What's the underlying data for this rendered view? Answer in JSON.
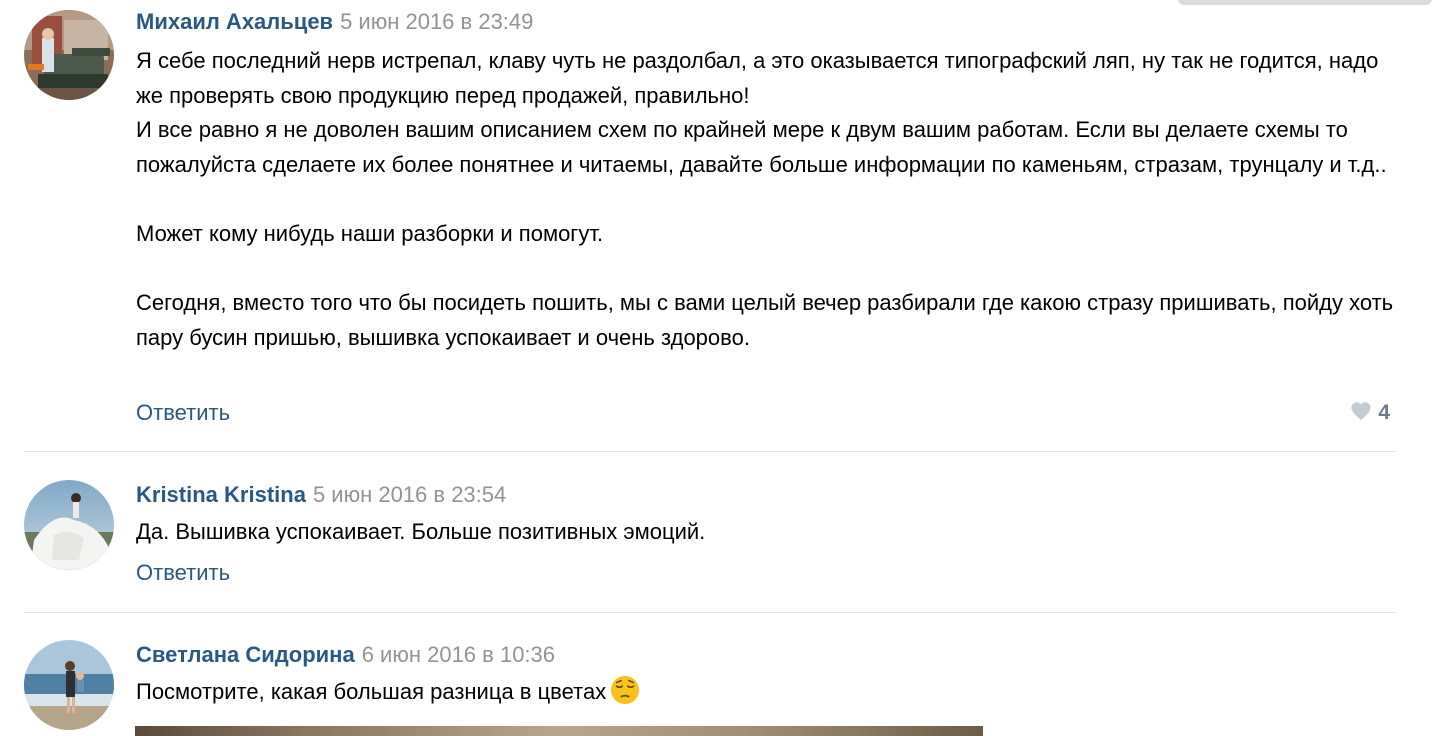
{
  "comments": [
    {
      "author": "Михаил Ахальцев",
      "date": "5 июн 2016 в 23:49",
      "paragraphs": [
        "Я себе последний нерв истрепал, клаву чуть не раздолбал, а это оказывается типографский ляп, ну так не годится, надо же проверять свою продукцию перед продажей, правильно!",
        "И все равно я не доволен вашим описанием схем по крайней мере к двум вашим работам. Если вы делаете схемы то пожалуйста сделаете их более понятнее и читаемы, давайте больше информации по каменьям, стразам, трунцалу и т.д..",
        "",
        "Может кому нибудь наши разборки и помогут.",
        "",
        "Сегодня, вместо того что бы посидеть пошить, мы с вами целый вечер разбирали где какою стразу пришивать, пойду хоть пару бусин пришью, вышивка успокаивает и очень здорово."
      ],
      "reply_label": "Ответить",
      "likes": "4"
    },
    {
      "author": "Kristina Kristina",
      "date": "5 июн 2016 в 23:54",
      "text": "Да. Вышивка успокаивает. Больше позитивных эмоций.",
      "reply_label": "Ответить"
    },
    {
      "author": "Светлана Сидорина",
      "date": "6 июн 2016 в 10:36",
      "text": "Посмотрите, какая большая разница в цветах",
      "emoji": "pensive-face-emoji"
    }
  ],
  "icons": {
    "like": "heart-icon"
  },
  "colors": {
    "author_link": "#2a5885",
    "date": "#939393",
    "divider": "#e3e5e8",
    "like_count": "#6f7b88"
  }
}
